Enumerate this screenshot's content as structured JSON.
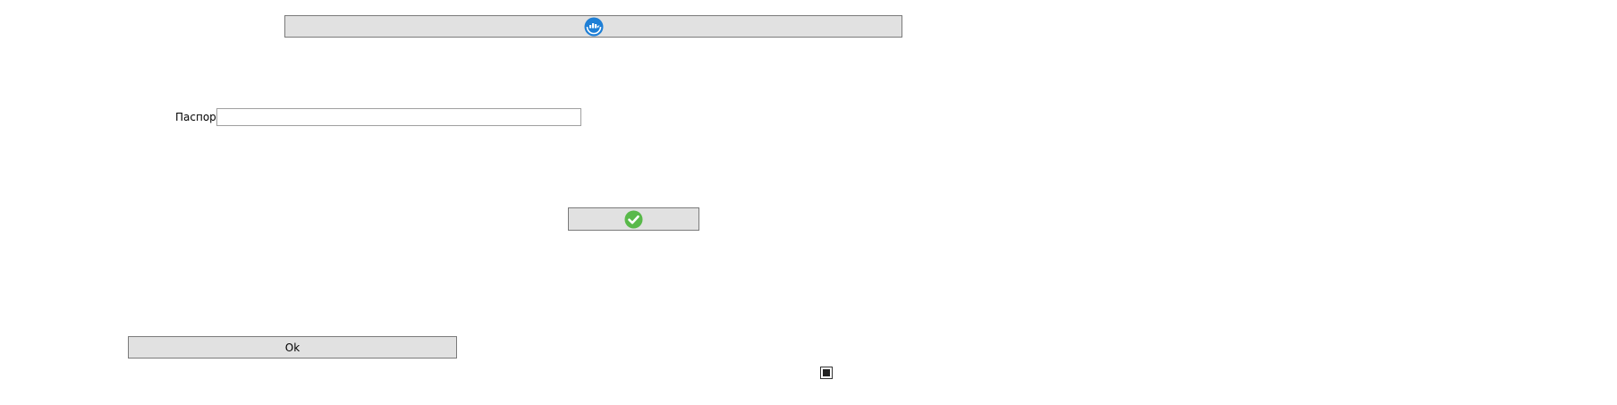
{
  "form": {
    "top_button": {
      "icon": "cloud-service-icon",
      "icon_color": "#1e7fd6"
    },
    "passport": {
      "label": "Паспорт",
      "value": "",
      "placeholder": ""
    },
    "confirm_button": {
      "icon": "green-check-icon",
      "icon_color": "#59b94a"
    },
    "ok_button": {
      "label": "Ok"
    },
    "checkbox": {
      "state": "indeterminate"
    }
  },
  "colors": {
    "button_background": "#e1e1e1",
    "button_border": "#7a7a7a",
    "input_border": "#a0a0a0",
    "background": "#ffffff"
  }
}
